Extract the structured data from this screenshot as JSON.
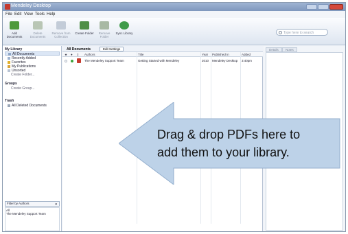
{
  "window": {
    "title": "Mendeley Desktop"
  },
  "menu": [
    "File",
    "Edit",
    "View",
    "Tools",
    "Help"
  ],
  "toolbar": {
    "buttons": [
      {
        "label": "Add Documents",
        "icon": "add-documents-icon"
      },
      {
        "label": "Delete Documents",
        "icon": "delete-documents-icon"
      },
      {
        "label": "Remove from Collection",
        "icon": "remove-from-collection-icon"
      },
      {
        "label": "Create Folder",
        "icon": "create-folder-icon"
      },
      {
        "label": "Remove Folder",
        "icon": "remove-folder-icon"
      },
      {
        "label": "Sync Library",
        "icon": "sync-library-icon"
      }
    ],
    "search_placeholder": "Type here to search"
  },
  "sidebar": {
    "my_library_heading": "My Library",
    "library_items": [
      "All Documents",
      "Recently Added",
      "Favorites",
      "My Publications",
      "Unsorted"
    ],
    "create_folder": "Create Folder...",
    "groups_heading": "Groups",
    "create_group": "Create Group...",
    "trash_heading": "Trash",
    "trash_item": "All Deleted Documents",
    "filter_label": "Filter by Authors",
    "filter_values": [
      "All",
      "The Mendeley Support Team"
    ]
  },
  "center": {
    "title": "All Documents",
    "edit_settings": "Edit Settings",
    "columns": [
      "Authors",
      "Title",
      "Year",
      "Published In",
      "Added"
    ],
    "rows": [
      {
        "authors": "The Mendeley Support Team",
        "title": "Getting Started with Mendeley",
        "year": "2010",
        "published_in": "Mendeley Desktop",
        "added": "3:40pm"
      }
    ]
  },
  "details": {
    "tabs": [
      "Details",
      "Notes"
    ]
  },
  "callout": {
    "line1": "Drag & drop PDFs here to",
    "line2": "add them to your library."
  }
}
